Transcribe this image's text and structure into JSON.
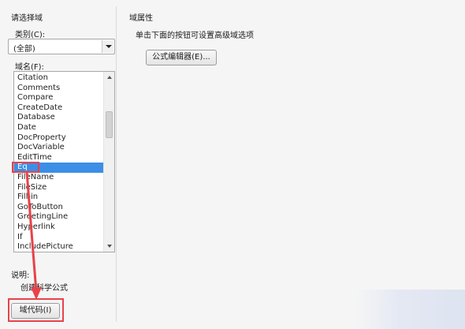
{
  "left": {
    "section_title": "请选择域",
    "category_label": "类别(C):",
    "category_value": "(全部)",
    "field_names_label": "域名(F):",
    "field_names": [
      "Citation",
      "Comments",
      "Compare",
      "CreateDate",
      "Database",
      "Date",
      "DocProperty",
      "DocVariable",
      "EditTime",
      "Eq",
      "FileName",
      "FileSize",
      "Fill-in",
      "GoToButton",
      "GreetingLine",
      "Hyperlink",
      "If",
      "IncludePicture"
    ],
    "selected_field": "Eq",
    "description_label": "说明:",
    "description_text": "创建科学公式",
    "field_codes_button": "域代码(I)"
  },
  "right": {
    "section_title": "域属性",
    "hint_text": "单击下面的按钮可设置高级域选项",
    "formula_editor_button": "公式编辑器(E)..."
  },
  "colors": {
    "selection": "#3d8ee6",
    "annotation": "#e8424a"
  }
}
